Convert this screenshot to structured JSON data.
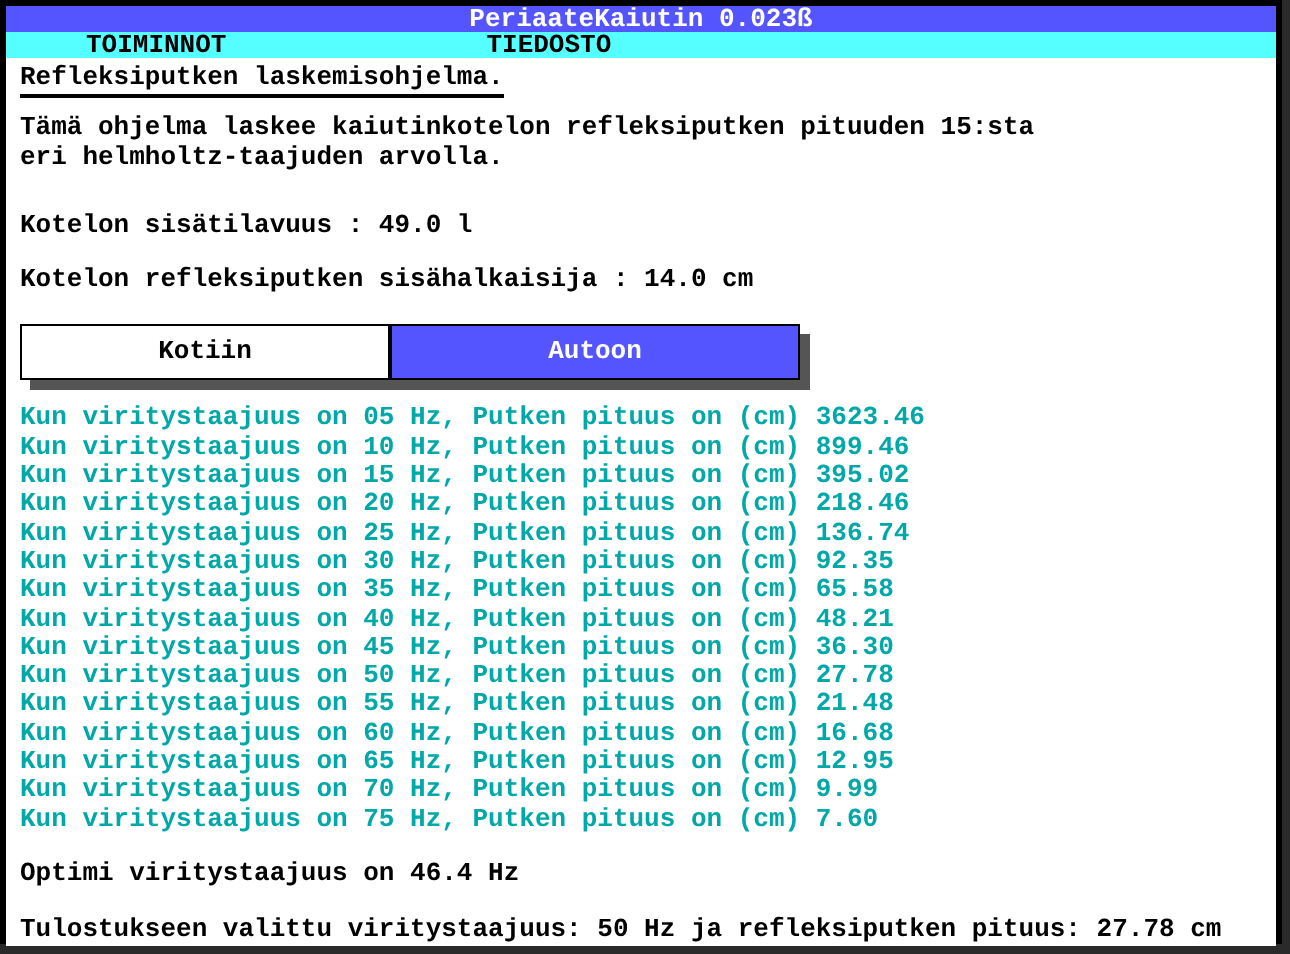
{
  "window": {
    "title": "PeriaateKaiutin 0.023ß"
  },
  "menu": [
    "TOIMINNOT",
    "TIEDOSTO"
  ],
  "heading": "Refleksiputken laskemisohjelma.",
  "description": [
    "Tämä ohjelma laskee kaiutinkotelon refleksiputken pituuden 15:sta",
    "eri helmholtz-taajuden arvolla."
  ],
  "volume": "Kotelon sisätilavuus : 49.0 l",
  "diameter": "Kotelon refleksiputken sisähalkaisija : 14.0 cm",
  "buttons": [
    {
      "label": "Kotiin",
      "selected": false
    },
    {
      "label": "Autoon",
      "selected": true
    }
  ],
  "results": [
    "Kun viritystaajuus on 05 Hz, Putken pituus on (cm) 3623.46",
    "Kun viritystaajuus on 10 Hz, Putken pituus on (cm) 899.46",
    "Kun viritystaajuus on 15 Hz, Putken pituus on (cm) 395.02",
    "Kun viritystaajuus on 20 Hz, Putken pituus on (cm) 218.46",
    "Kun viritystaajuus on 25 Hz, Putken pituus on (cm) 136.74",
    "Kun viritystaajuus on 30 Hz, Putken pituus on (cm) 92.35",
    "Kun viritystaajuus on 35 Hz, Putken pituus on (cm) 65.58",
    "Kun viritystaajuus on 40 Hz, Putken pituus on (cm) 48.21",
    "Kun viritystaajuus on 45 Hz, Putken pituus on (cm) 36.30",
    "Kun viritystaajuus on 50 Hz, Putken pituus on (cm) 27.78",
    "Kun viritystaajuus on 55 Hz, Putken pituus on (cm) 21.48",
    "Kun viritystaajuus on 60 Hz, Putken pituus on (cm) 16.68",
    "Kun viritystaajuus on 65 Hz, Putken pituus on (cm) 12.95",
    "Kun viritystaajuus on 70 Hz, Putken pituus on (cm) 9.99",
    "Kun viritystaajuus on 75 Hz, Putken pituus on (cm) 7.60"
  ],
  "optimum": "Optimi viritystaajuus on 46.4 Hz",
  "output": "Tulostukseen valittu viritystaajuus: 50 Hz ja refleksiputken pituus: 27.78 cm"
}
